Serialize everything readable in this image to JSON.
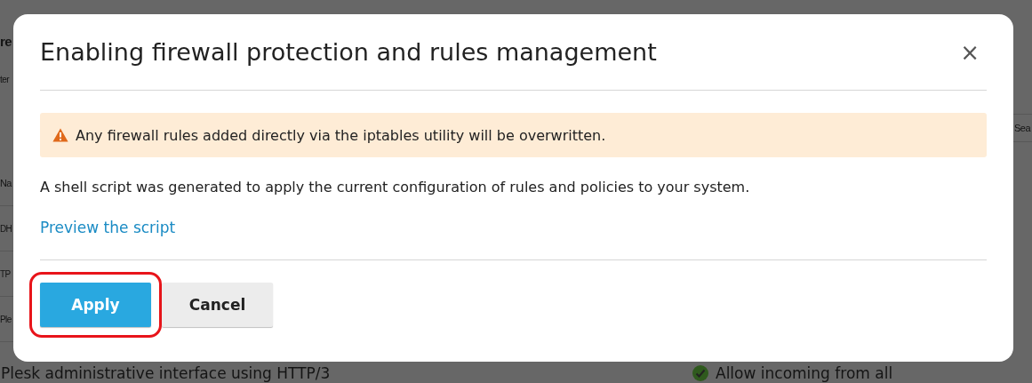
{
  "background_page": {
    "title": "re",
    "subtitle": "ter",
    "search": {
      "placeholder": "Sea"
    },
    "column_1": "Na",
    "rows": [
      {
        "name": "DH"
      },
      {
        "name": "TP"
      },
      {
        "name": "Ple"
      }
    ],
    "last_row": {
      "name": "Plesk administrative interface using HTTP/3",
      "action": "Allow incoming from all"
    }
  },
  "dialog": {
    "title": "Enabling firewall protection and rules management",
    "close": "×",
    "warning": "Any firewall rules added directly via the iptables utility will be overwritten.",
    "text": "A shell script was generated to apply the current configuration of rules and policies to your system.",
    "link": "Preview the script",
    "buttons": [
      {
        "label": "Apply",
        "kind": "primary",
        "highlighted": true
      },
      {
        "label": "Cancel",
        "kind": "secondary",
        "highlighted": false
      }
    ]
  }
}
